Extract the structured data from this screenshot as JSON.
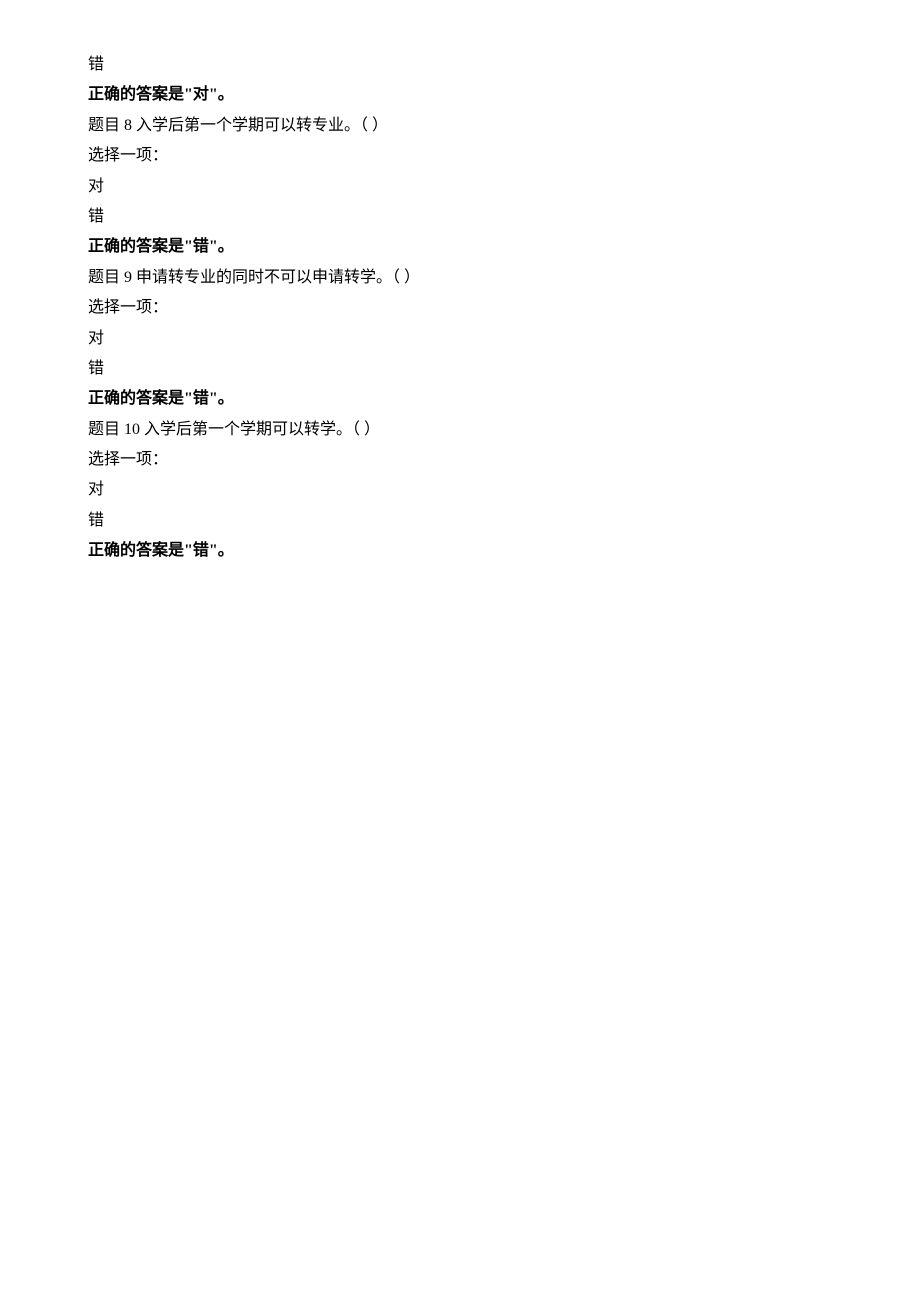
{
  "questions": [
    {
      "preceding_incorrect": "错",
      "preceding_answer": "正确的答案是\"对\"。",
      "prompt": "题目 8 入学后第一个学期可以转专业。（ ）",
      "select_one": "选择一项：",
      "option_true": "对",
      "option_false": "错",
      "answer": "正确的答案是\"错\"。"
    },
    {
      "prompt": "题目 9 申请转专业的同时不可以申请转学。（ ）",
      "select_one": "选择一项：",
      "option_true": "对",
      "option_false": "错",
      "answer": "正确的答案是\"错\"。"
    },
    {
      "prompt": "题目 10 入学后第一个学期可以转学。（ ）",
      "select_one": "选择一项：",
      "option_true": "对",
      "option_false": "错",
      "answer": "正确的答案是\"错\"。"
    }
  ]
}
